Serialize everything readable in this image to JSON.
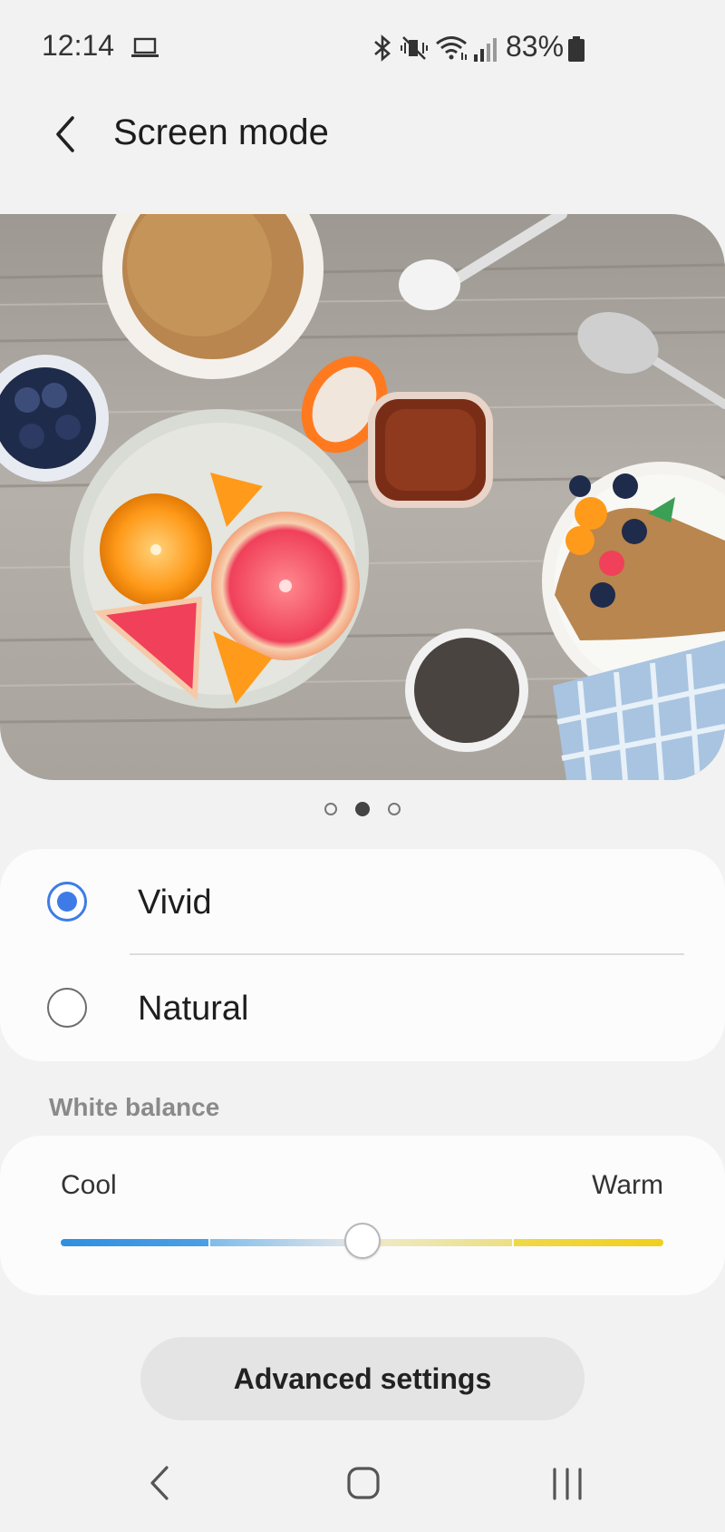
{
  "status_bar": {
    "time": "12:14",
    "battery": "83%",
    "icons": [
      "laptop-icon",
      "bluetooth-icon",
      "vibrate-mute-icon",
      "wifi-icon",
      "signal-icon",
      "battery-icon"
    ]
  },
  "header": {
    "title": "Screen mode",
    "back_icon": "chevron-left-icon"
  },
  "preview": {
    "pager_count": 3,
    "active_page": 2
  },
  "screen_modes": [
    {
      "label": "Vivid",
      "selected": true
    },
    {
      "label": "Natural",
      "selected": false
    }
  ],
  "white_balance": {
    "section_title": "White balance",
    "cool_label": "Cool",
    "warm_label": "Warm",
    "value": 0.5,
    "colors": {
      "cool": "#2f8fe0",
      "warm": "#f2cf1a",
      "neutral": "#e6e8ea"
    }
  },
  "advanced_settings": {
    "label": "Advanced settings"
  },
  "nav_bar": {
    "icons": [
      "nav-back-icon",
      "nav-home-icon",
      "nav-recents-icon"
    ]
  },
  "colors": {
    "accent": "#3e7be7",
    "background": "#f2f2f2",
    "card": "#fcfcfc"
  }
}
